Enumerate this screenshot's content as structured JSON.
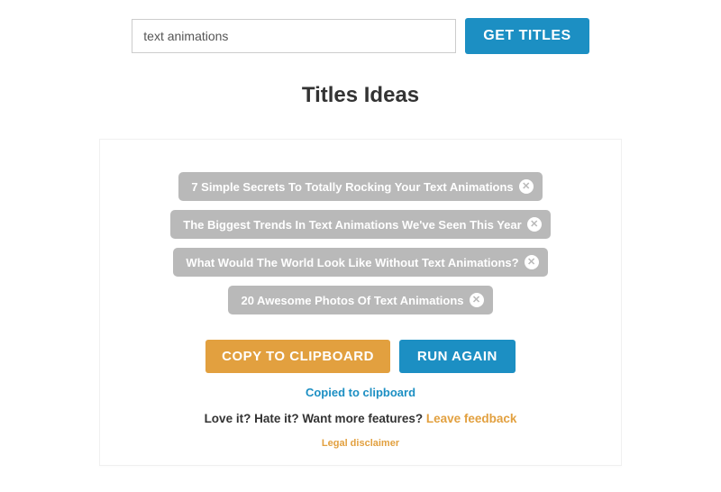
{
  "search": {
    "value": "text animations",
    "button_label": "GET TITLES"
  },
  "heading": "Titles Ideas",
  "results": {
    "items": [
      {
        "text": "7 Simple Secrets To Totally Rocking Your Text Animations"
      },
      {
        "text": "The Biggest Trends In Text Animations We've Seen This Year"
      },
      {
        "text": "What Would The World Look Like Without Text Animations?"
      },
      {
        "text": "20 Awesome Photos Of Text Animations"
      }
    ],
    "close_glyph": "✕"
  },
  "actions": {
    "copy_label": "COPY TO CLIPBOARD",
    "run_label": "RUN AGAIN"
  },
  "status": {
    "copied": "Copied to clipboard"
  },
  "feedback": {
    "prompt": "Love it? Hate it? Want more features? ",
    "link_label": "Leave feedback"
  },
  "legal": {
    "disclaimer_label": "Legal disclaimer"
  }
}
